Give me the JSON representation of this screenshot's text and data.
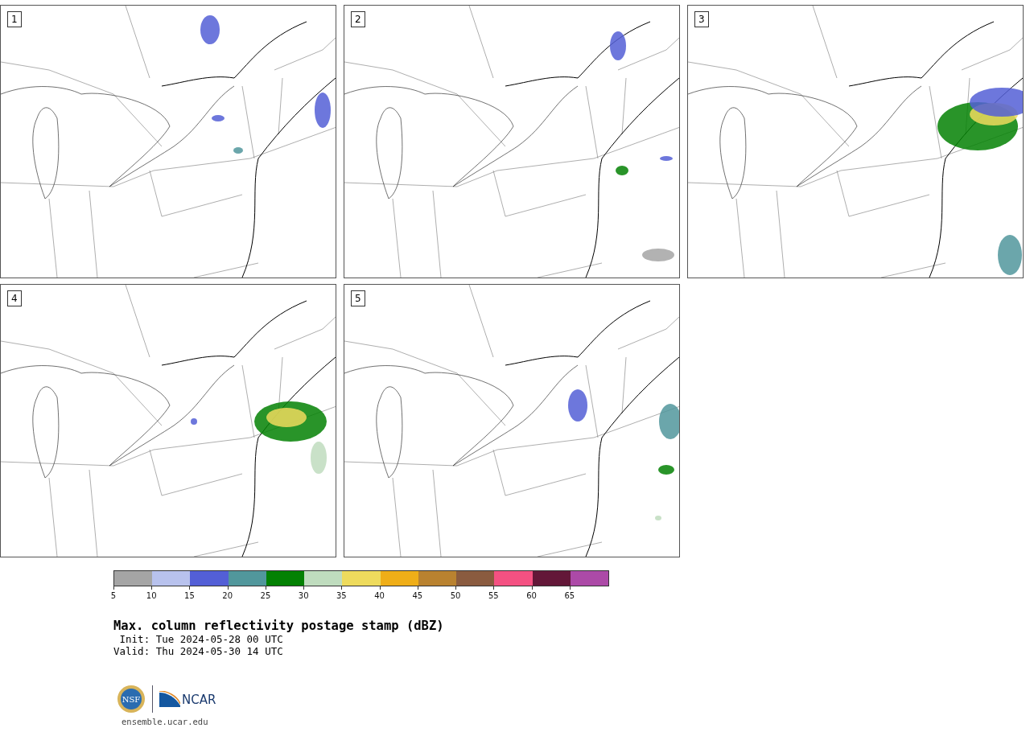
{
  "panels": [
    {
      "label": "1"
    },
    {
      "label": "2"
    },
    {
      "label": "3"
    },
    {
      "label": "4"
    },
    {
      "label": "5"
    }
  ],
  "colorbar": {
    "bins": [
      {
        "color": "#a5a5a5"
      },
      {
        "color": "#b8c2ed"
      },
      {
        "color": "#535fd6"
      },
      {
        "color": "#51979c"
      },
      {
        "color": "#038103"
      },
      {
        "color": "#bfdcbe"
      },
      {
        "color": "#eedb5d"
      },
      {
        "color": "#efae18"
      },
      {
        "color": "#b98230"
      },
      {
        "color": "#8a5b3f"
      },
      {
        "color": "#f45182"
      },
      {
        "color": "#631738"
      },
      {
        "color": "#ac4aa7"
      }
    ],
    "ticks": [
      "5",
      "10",
      "15",
      "20",
      "25",
      "30",
      "35",
      "40",
      "45",
      "50",
      "55",
      "60",
      "65"
    ]
  },
  "title": "Max. column reflectivity postage stamp (dBZ)",
  "init": " Init: Tue 2024-05-28 00 UTC",
  "valid": "Valid: Thu 2024-05-30 14 UTC",
  "logos": {
    "nsf": "NSF",
    "ncar": "NCAR"
  },
  "site": "ensemble.ucar.edu"
}
